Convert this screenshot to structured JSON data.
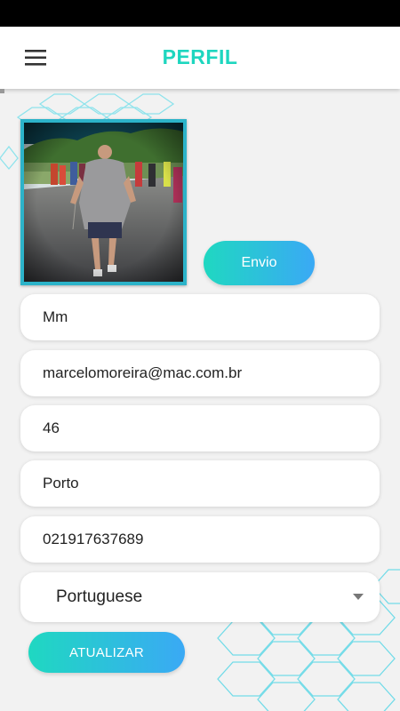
{
  "header": {
    "title": "PERFIL",
    "menu_icon": "hamburger-menu-icon"
  },
  "profile": {
    "photo_alt": "Profile photo"
  },
  "buttons": {
    "send_label": "Envio",
    "update_label": "ATUALIZAR"
  },
  "fields": {
    "name": "Mm",
    "email": "marcelomoreira@mac.com.br",
    "age": "46",
    "city": "Porto",
    "phone": "021917637689"
  },
  "language_select": {
    "selected": "Portuguese",
    "caret_icon": "dropdown-caret-icon"
  },
  "colors": {
    "accent": "#1ed6bf",
    "gradient_start": "#1fd8c1",
    "gradient_end": "#3aa9f5",
    "hex_lines": "#5cd7e6"
  }
}
